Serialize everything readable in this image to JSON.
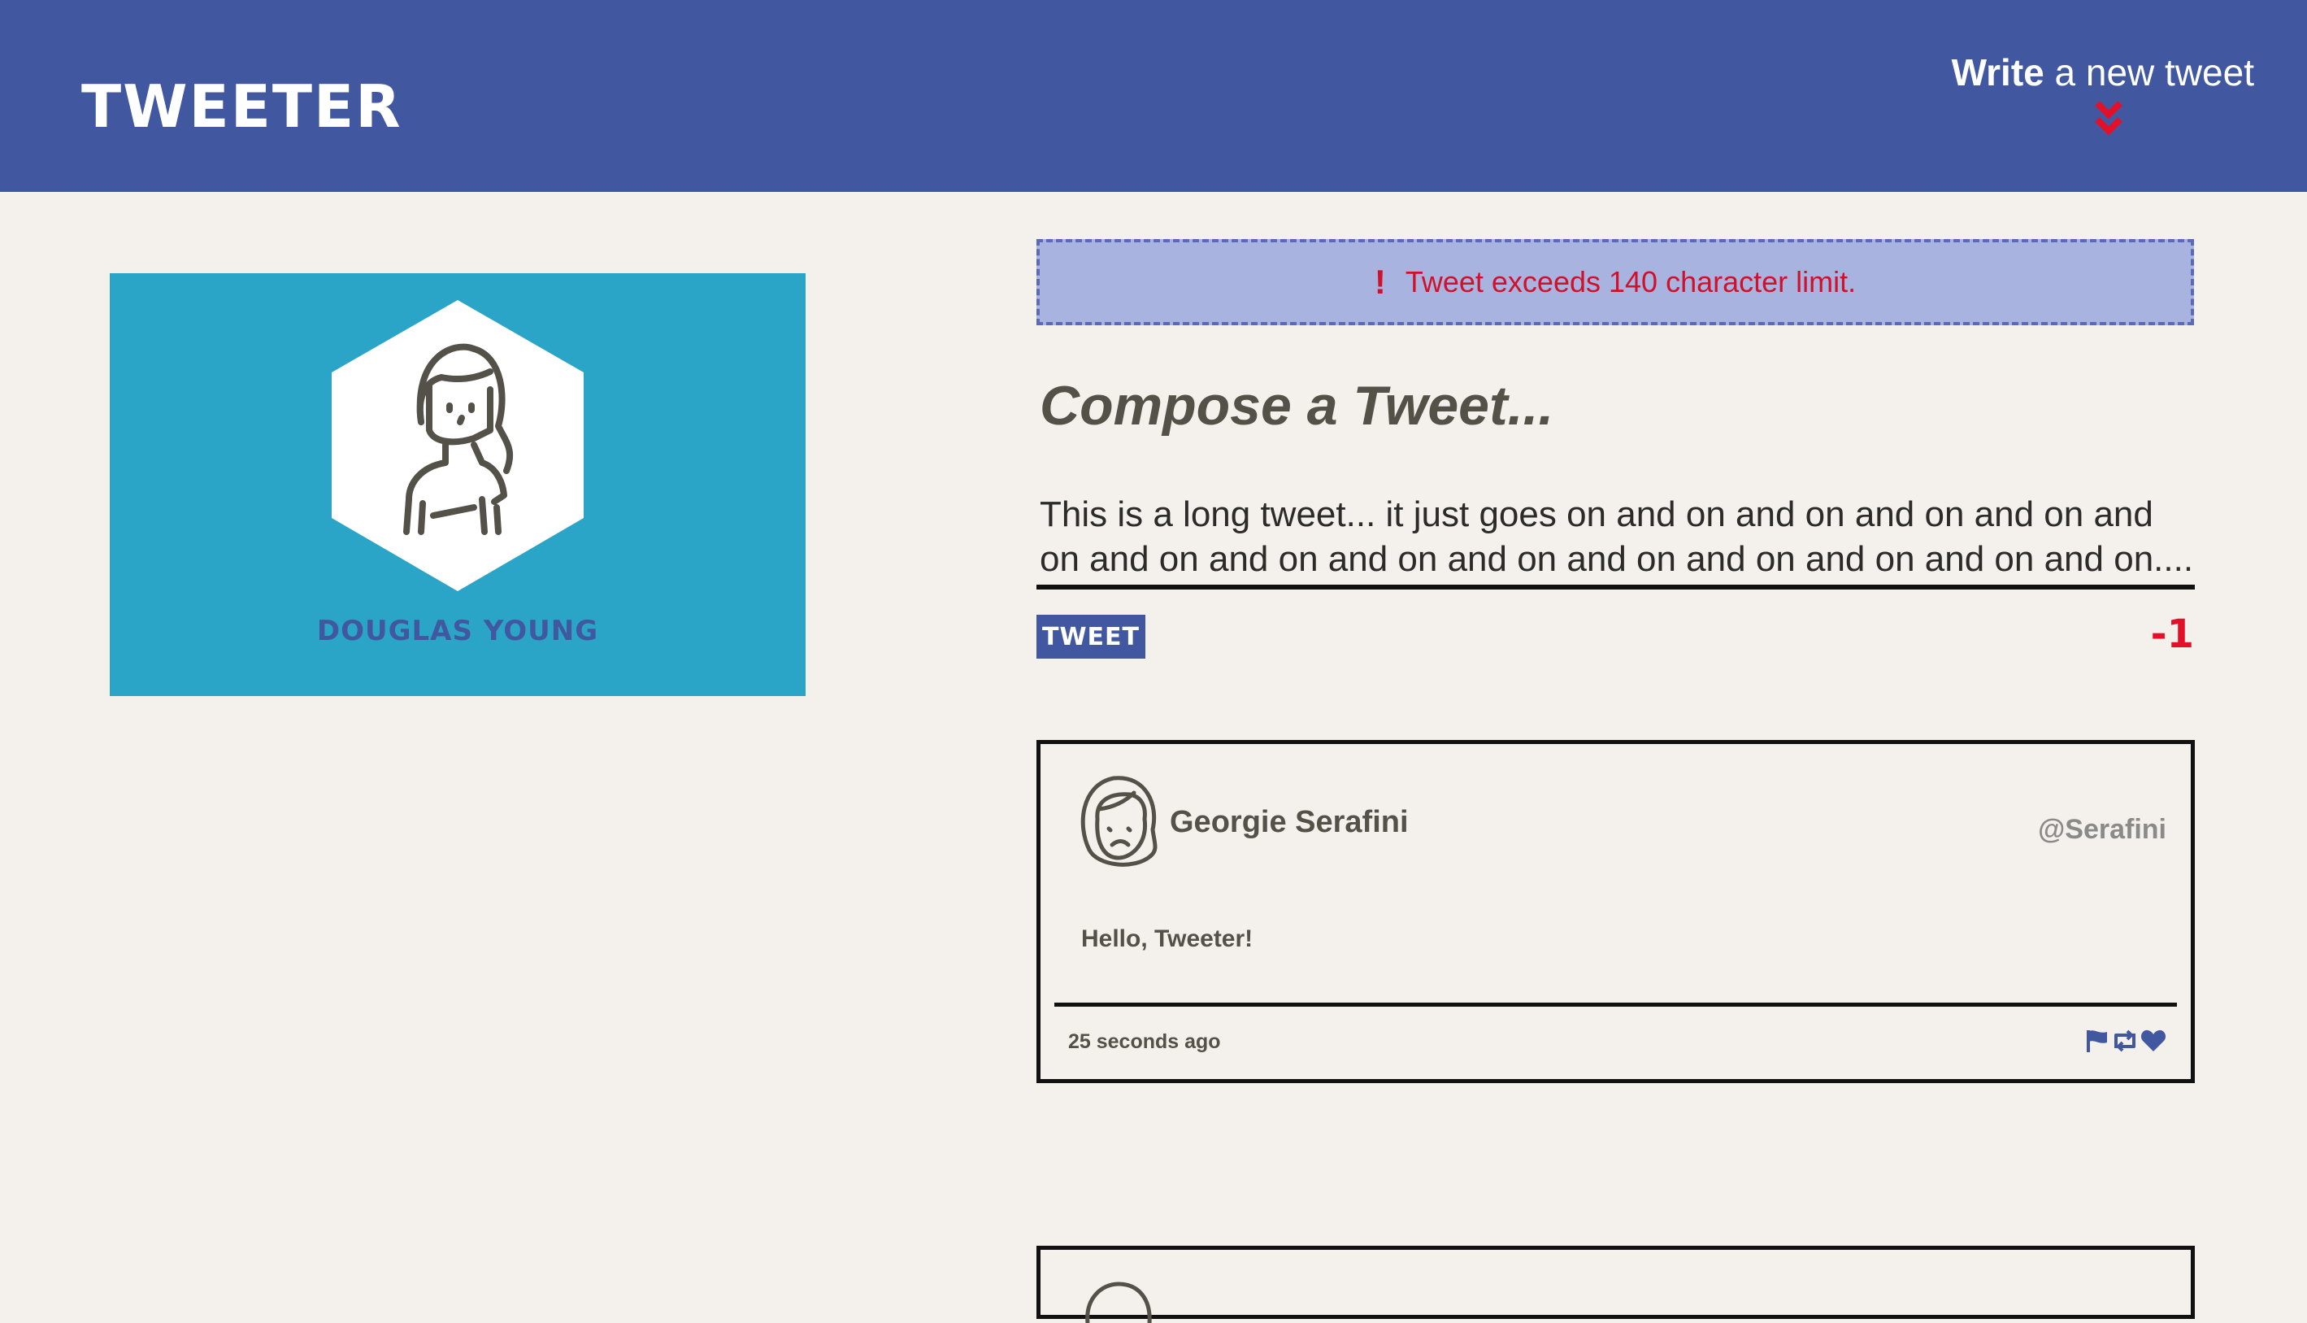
{
  "nav": {
    "brand": "TWEETER",
    "write_strong": "Write",
    "write_rest": " a new tweet",
    "arrow_icon": "double-chevron-down-icon",
    "background_color": "#4158a0",
    "arrow_color": "#e3102a"
  },
  "profile": {
    "name": "DOUGLAS YOUNG",
    "background_color": "#2aa5c8"
  },
  "compose": {
    "error_icon": "!",
    "error_text": "Tweet exceeds 140 character limit.",
    "title": "Compose a Tweet...",
    "text": "This is a long tweet... it just goes on and on and on and on and on and on and on and on and on and on and on and on and on and on and on....",
    "tweet_button": "TWEET",
    "counter": "-1",
    "error_color": "#d0112b"
  },
  "tweets": [
    {
      "author": "Georgie Serafini",
      "handle": "@Serafini",
      "body": "Hello, Tweeter!",
      "timestamp": "25 seconds ago",
      "action_icons": [
        "flag-icon",
        "retweet-icon",
        "heart-icon"
      ]
    }
  ]
}
